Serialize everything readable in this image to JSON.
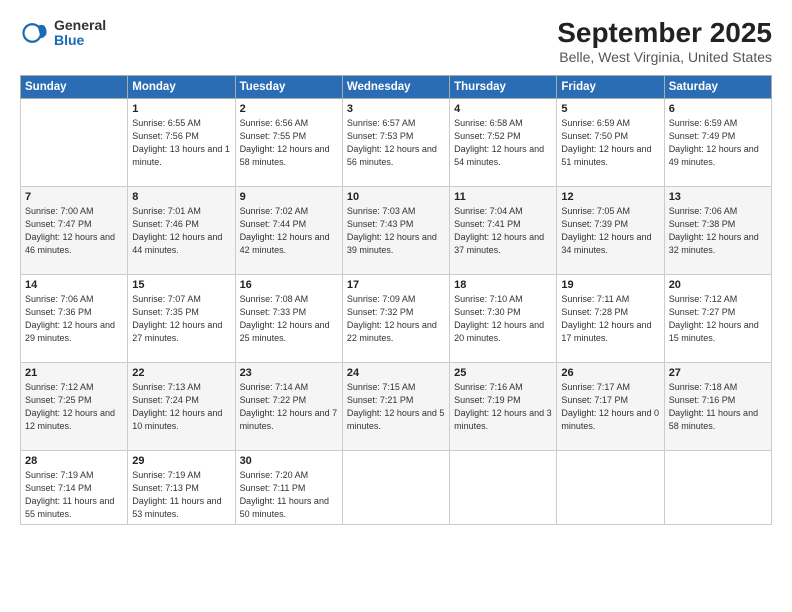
{
  "title": "September 2025",
  "subtitle": "Belle, West Virginia, United States",
  "logo": {
    "line1": "General",
    "line2": "Blue"
  },
  "days_header": [
    "Sunday",
    "Monday",
    "Tuesday",
    "Wednesday",
    "Thursday",
    "Friday",
    "Saturday"
  ],
  "weeks": [
    [
      {
        "day": "",
        "empty": true
      },
      {
        "day": "1",
        "sunrise": "Sunrise: 6:55 AM",
        "sunset": "Sunset: 7:56 PM",
        "daylight": "Daylight: 13 hours and 1 minute."
      },
      {
        "day": "2",
        "sunrise": "Sunrise: 6:56 AM",
        "sunset": "Sunset: 7:55 PM",
        "daylight": "Daylight: 12 hours and 58 minutes."
      },
      {
        "day": "3",
        "sunrise": "Sunrise: 6:57 AM",
        "sunset": "Sunset: 7:53 PM",
        "daylight": "Daylight: 12 hours and 56 minutes."
      },
      {
        "day": "4",
        "sunrise": "Sunrise: 6:58 AM",
        "sunset": "Sunset: 7:52 PM",
        "daylight": "Daylight: 12 hours and 54 minutes."
      },
      {
        "day": "5",
        "sunrise": "Sunrise: 6:59 AM",
        "sunset": "Sunset: 7:50 PM",
        "daylight": "Daylight: 12 hours and 51 minutes."
      },
      {
        "day": "6",
        "sunrise": "Sunrise: 6:59 AM",
        "sunset": "Sunset: 7:49 PM",
        "daylight": "Daylight: 12 hours and 49 minutes."
      }
    ],
    [
      {
        "day": "7",
        "sunrise": "Sunrise: 7:00 AM",
        "sunset": "Sunset: 7:47 PM",
        "daylight": "Daylight: 12 hours and 46 minutes."
      },
      {
        "day": "8",
        "sunrise": "Sunrise: 7:01 AM",
        "sunset": "Sunset: 7:46 PM",
        "daylight": "Daylight: 12 hours and 44 minutes."
      },
      {
        "day": "9",
        "sunrise": "Sunrise: 7:02 AM",
        "sunset": "Sunset: 7:44 PM",
        "daylight": "Daylight: 12 hours and 42 minutes."
      },
      {
        "day": "10",
        "sunrise": "Sunrise: 7:03 AM",
        "sunset": "Sunset: 7:43 PM",
        "daylight": "Daylight: 12 hours and 39 minutes."
      },
      {
        "day": "11",
        "sunrise": "Sunrise: 7:04 AM",
        "sunset": "Sunset: 7:41 PM",
        "daylight": "Daylight: 12 hours and 37 minutes."
      },
      {
        "day": "12",
        "sunrise": "Sunrise: 7:05 AM",
        "sunset": "Sunset: 7:39 PM",
        "daylight": "Daylight: 12 hours and 34 minutes."
      },
      {
        "day": "13",
        "sunrise": "Sunrise: 7:06 AM",
        "sunset": "Sunset: 7:38 PM",
        "daylight": "Daylight: 12 hours and 32 minutes."
      }
    ],
    [
      {
        "day": "14",
        "sunrise": "Sunrise: 7:06 AM",
        "sunset": "Sunset: 7:36 PM",
        "daylight": "Daylight: 12 hours and 29 minutes."
      },
      {
        "day": "15",
        "sunrise": "Sunrise: 7:07 AM",
        "sunset": "Sunset: 7:35 PM",
        "daylight": "Daylight: 12 hours and 27 minutes."
      },
      {
        "day": "16",
        "sunrise": "Sunrise: 7:08 AM",
        "sunset": "Sunset: 7:33 PM",
        "daylight": "Daylight: 12 hours and 25 minutes."
      },
      {
        "day": "17",
        "sunrise": "Sunrise: 7:09 AM",
        "sunset": "Sunset: 7:32 PM",
        "daylight": "Daylight: 12 hours and 22 minutes."
      },
      {
        "day": "18",
        "sunrise": "Sunrise: 7:10 AM",
        "sunset": "Sunset: 7:30 PM",
        "daylight": "Daylight: 12 hours and 20 minutes."
      },
      {
        "day": "19",
        "sunrise": "Sunrise: 7:11 AM",
        "sunset": "Sunset: 7:28 PM",
        "daylight": "Daylight: 12 hours and 17 minutes."
      },
      {
        "day": "20",
        "sunrise": "Sunrise: 7:12 AM",
        "sunset": "Sunset: 7:27 PM",
        "daylight": "Daylight: 12 hours and 15 minutes."
      }
    ],
    [
      {
        "day": "21",
        "sunrise": "Sunrise: 7:12 AM",
        "sunset": "Sunset: 7:25 PM",
        "daylight": "Daylight: 12 hours and 12 minutes."
      },
      {
        "day": "22",
        "sunrise": "Sunrise: 7:13 AM",
        "sunset": "Sunset: 7:24 PM",
        "daylight": "Daylight: 12 hours and 10 minutes."
      },
      {
        "day": "23",
        "sunrise": "Sunrise: 7:14 AM",
        "sunset": "Sunset: 7:22 PM",
        "daylight": "Daylight: 12 hours and 7 minutes."
      },
      {
        "day": "24",
        "sunrise": "Sunrise: 7:15 AM",
        "sunset": "Sunset: 7:21 PM",
        "daylight": "Daylight: 12 hours and 5 minutes."
      },
      {
        "day": "25",
        "sunrise": "Sunrise: 7:16 AM",
        "sunset": "Sunset: 7:19 PM",
        "daylight": "Daylight: 12 hours and 3 minutes."
      },
      {
        "day": "26",
        "sunrise": "Sunrise: 7:17 AM",
        "sunset": "Sunset: 7:17 PM",
        "daylight": "Daylight: 12 hours and 0 minutes."
      },
      {
        "day": "27",
        "sunrise": "Sunrise: 7:18 AM",
        "sunset": "Sunset: 7:16 PM",
        "daylight": "Daylight: 11 hours and 58 minutes."
      }
    ],
    [
      {
        "day": "28",
        "sunrise": "Sunrise: 7:19 AM",
        "sunset": "Sunset: 7:14 PM",
        "daylight": "Daylight: 11 hours and 55 minutes."
      },
      {
        "day": "29",
        "sunrise": "Sunrise: 7:19 AM",
        "sunset": "Sunset: 7:13 PM",
        "daylight": "Daylight: 11 hours and 53 minutes."
      },
      {
        "day": "30",
        "sunrise": "Sunrise: 7:20 AM",
        "sunset": "Sunset: 7:11 PM",
        "daylight": "Daylight: 11 hours and 50 minutes."
      },
      {
        "day": "",
        "empty": true
      },
      {
        "day": "",
        "empty": true
      },
      {
        "day": "",
        "empty": true
      },
      {
        "day": "",
        "empty": true
      }
    ]
  ]
}
